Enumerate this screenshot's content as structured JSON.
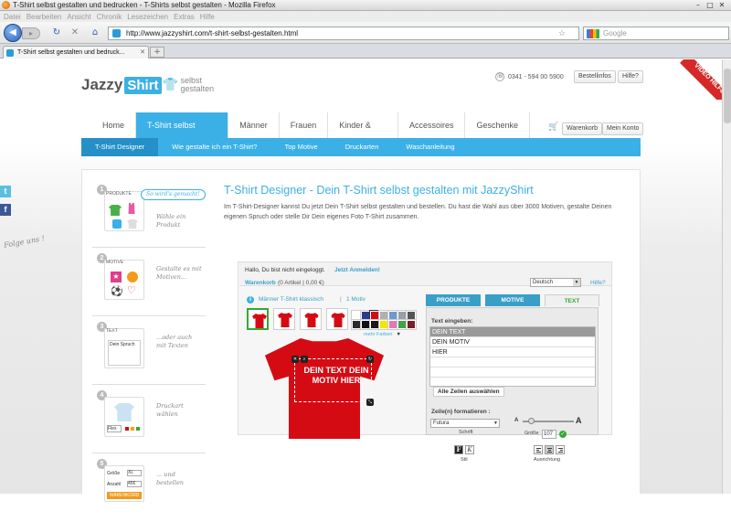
{
  "browser": {
    "window_title": "T-Shirt selbst gestalten und bedrucken - T-Shirts selbst gestalten - Mozilla Firefox",
    "menu": [
      "Datei",
      "Bearbeiten",
      "Ansicht",
      "Chronik",
      "Lesezeichen",
      "Extras",
      "Hilfe"
    ],
    "url": "http://www.jazzyshirt.com/t-shirt-selbst-gestalten.html",
    "search_placeholder": "Google",
    "tab_title": "T-Shirt selbst gestalten und bedruck...",
    "new_tab": "+"
  },
  "site": {
    "logo_main": "Jazzy",
    "logo_badge": "Shirt",
    "logo_tagline_1": "selbst",
    "logo_tagline_2": "gestalten",
    "phone": "0341 - 594 00 5900",
    "bestellinfos": "Bestellinfos",
    "hilfe": "Hilfe?",
    "video_badge": "VIDEO HILFE",
    "nav": [
      "Home",
      "T-Shirt selbst gestalten",
      "Männer",
      "Frauen",
      "Kinder & Babys",
      "Accessoires",
      "Geschenke"
    ],
    "warenkorb": "Warenkorb",
    "mein_konto": "Mein Konto",
    "subnav": [
      "T-Shirt Designer",
      "Wie gestalte ich ein T-Shirt?",
      "Top Motive",
      "Druckarten",
      "Waschanleitung"
    ],
    "folge": "Folge uns !",
    "social": [
      "t",
      "f"
    ]
  },
  "steps": {
    "howto": "So wird's gemacht!",
    "items": [
      {
        "num": "1",
        "label": "PRODUKTE",
        "desc": "Wähle ein Produkt"
      },
      {
        "num": "2",
        "label": "MOTIVE",
        "desc": "Gestalte es mit Motiven..."
      },
      {
        "num": "3",
        "label": "TEXT",
        "desc": "...oder auch mit Texten",
        "sample": "Dein Spruch"
      },
      {
        "num": "4",
        "label": "",
        "desc": "Druckart wählen",
        "sample": "Flex"
      },
      {
        "num": "5",
        "label": "",
        "desc": "... und bestellen",
        "size_label": "Größe",
        "size_val": "XL",
        "qty_label": "Anzahl",
        "qty_val": "45€",
        "cart_btn": "WARENKORB"
      }
    ]
  },
  "main": {
    "title": "T-Shirt Designer - Dein T-Shirt selbst gestalten mit JazzyShirt",
    "intro": "Im T-Shirt-Designer kannst Du jetzt Dein T-Shirt selbst gestalten und bestellen. Du hast die Wahl aus über 3000 Motiven, gestalte Deinen eigenen Spruch oder stelle Dir Dein eigenes Foto T-Shirt zusammen."
  },
  "designer": {
    "greeting": "Hallo, Du bist nicht eingeloggt.",
    "login": "Jetzt Anmelden!",
    "cart_label": "Warenkorb",
    "cart_info": "(0 Artikel | 0,00 €)",
    "language": "Deutsch",
    "help": "Hilfe?",
    "product": "Männer T-Shirt klassisch",
    "motive_count": "1 Motiv",
    "more_colors": "mehr Farben",
    "shirt_text": "DEIN TEXT DEIN MOTIV HIER",
    "tabs": [
      "PRODUKTE",
      "MOTIVE",
      "TEXT"
    ],
    "text_input_label": "Text eingeben:",
    "text_lines": [
      "DEIN TEXT",
      "DEIN MOTIV",
      "HIER",
      "",
      "",
      ""
    ],
    "select_all": "Alle Zeilen auswählen",
    "format_label": "Zeile(n) formatieren :",
    "font": "Futura",
    "font_label": "Schrift",
    "size_small": "A",
    "size_big": "A",
    "size_label": "Größe",
    "size_value": "107",
    "bold": "F",
    "italic": "K",
    "style_label": "Stil",
    "align_label": "Ausrichtung",
    "swatches": [
      "#ffffff",
      "#2b3d8f",
      "#d50b14",
      "#b0b0b0",
      "#6a9bd3",
      "#9aa0a6",
      "#555555",
      "#2a2a2a",
      "#111111",
      "#1a1a1a",
      "#f3e600",
      "#e07ab8",
      "#3fa348",
      "#7a1f2a"
    ]
  },
  "colors": {
    "accent": "#3bb0e6",
    "shirt": "#d50b14",
    "green": "#33aa33",
    "video": "#d62828"
  }
}
